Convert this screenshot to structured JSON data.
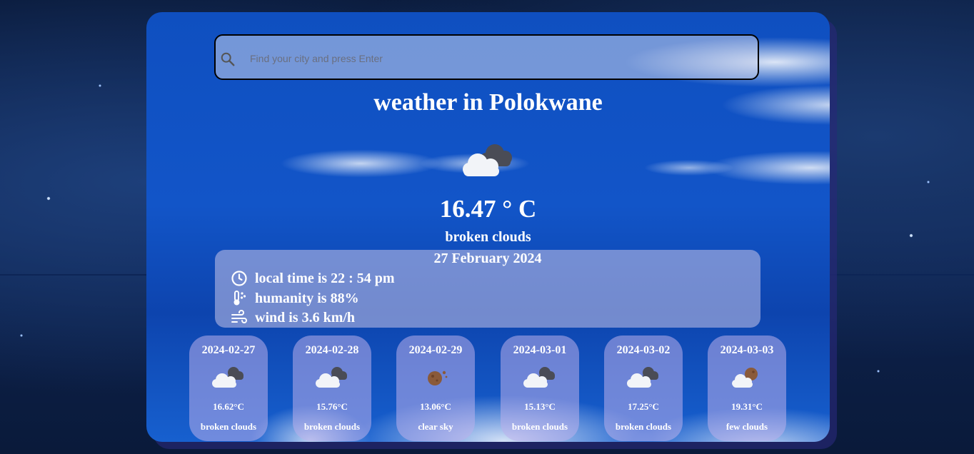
{
  "search": {
    "placeholder": "Find your city and press Enter",
    "icon": "search-icon"
  },
  "current": {
    "title": "weather in Polokwane",
    "icon": "broken-clouds-icon",
    "temperature": "16.47 ° C",
    "description": "broken clouds"
  },
  "details": {
    "date": "27 February 2024",
    "local_time": "local time is 22 : 54 pm",
    "humidity": "humanity is 88%",
    "wind": "wind is 3.6 km/h"
  },
  "forecast": [
    {
      "date": "2024-02-27",
      "temp": "16.62°C",
      "desc": "broken clouds",
      "icon": "broken-clouds-icon"
    },
    {
      "date": "2024-02-28",
      "temp": "15.76°C",
      "desc": "broken clouds",
      "icon": "broken-clouds-icon"
    },
    {
      "date": "2024-02-29",
      "temp": "13.06°C",
      "desc": "clear sky",
      "icon": "clear-sky-night-icon"
    },
    {
      "date": "2024-03-01",
      "temp": "15.13°C",
      "desc": "broken clouds",
      "icon": "broken-clouds-icon"
    },
    {
      "date": "2024-03-02",
      "temp": "17.25°C",
      "desc": "broken clouds",
      "icon": "broken-clouds-icon"
    },
    {
      "date": "2024-03-03",
      "temp": "19.31°C",
      "desc": "few clouds",
      "icon": "few-clouds-night-icon"
    }
  ]
}
